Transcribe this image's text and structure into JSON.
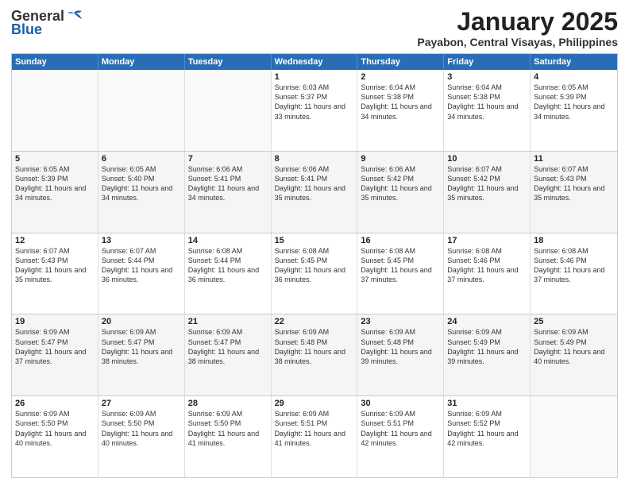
{
  "logo": {
    "line1": "General",
    "line2": "Blue"
  },
  "title": "January 2025",
  "subtitle": "Payabon, Central Visayas, Philippines",
  "days": [
    "Sunday",
    "Monday",
    "Tuesday",
    "Wednesday",
    "Thursday",
    "Friday",
    "Saturday"
  ],
  "weeks": [
    [
      {
        "num": "",
        "info": ""
      },
      {
        "num": "",
        "info": ""
      },
      {
        "num": "",
        "info": ""
      },
      {
        "num": "1",
        "info": "Sunrise: 6:03 AM\nSunset: 5:37 PM\nDaylight: 11 hours and 33 minutes."
      },
      {
        "num": "2",
        "info": "Sunrise: 6:04 AM\nSunset: 5:38 PM\nDaylight: 11 hours and 34 minutes."
      },
      {
        "num": "3",
        "info": "Sunrise: 6:04 AM\nSunset: 5:38 PM\nDaylight: 11 hours and 34 minutes."
      },
      {
        "num": "4",
        "info": "Sunrise: 6:05 AM\nSunset: 5:39 PM\nDaylight: 11 hours and 34 minutes."
      }
    ],
    [
      {
        "num": "5",
        "info": "Sunrise: 6:05 AM\nSunset: 5:39 PM\nDaylight: 11 hours and 34 minutes."
      },
      {
        "num": "6",
        "info": "Sunrise: 6:05 AM\nSunset: 5:40 PM\nDaylight: 11 hours and 34 minutes."
      },
      {
        "num": "7",
        "info": "Sunrise: 6:06 AM\nSunset: 5:41 PM\nDaylight: 11 hours and 34 minutes."
      },
      {
        "num": "8",
        "info": "Sunrise: 6:06 AM\nSunset: 5:41 PM\nDaylight: 11 hours and 35 minutes."
      },
      {
        "num": "9",
        "info": "Sunrise: 6:06 AM\nSunset: 5:42 PM\nDaylight: 11 hours and 35 minutes."
      },
      {
        "num": "10",
        "info": "Sunrise: 6:07 AM\nSunset: 5:42 PM\nDaylight: 11 hours and 35 minutes."
      },
      {
        "num": "11",
        "info": "Sunrise: 6:07 AM\nSunset: 5:43 PM\nDaylight: 11 hours and 35 minutes."
      }
    ],
    [
      {
        "num": "12",
        "info": "Sunrise: 6:07 AM\nSunset: 5:43 PM\nDaylight: 11 hours and 35 minutes."
      },
      {
        "num": "13",
        "info": "Sunrise: 6:07 AM\nSunset: 5:44 PM\nDaylight: 11 hours and 36 minutes."
      },
      {
        "num": "14",
        "info": "Sunrise: 6:08 AM\nSunset: 5:44 PM\nDaylight: 11 hours and 36 minutes."
      },
      {
        "num": "15",
        "info": "Sunrise: 6:08 AM\nSunset: 5:45 PM\nDaylight: 11 hours and 36 minutes."
      },
      {
        "num": "16",
        "info": "Sunrise: 6:08 AM\nSunset: 5:45 PM\nDaylight: 11 hours and 37 minutes."
      },
      {
        "num": "17",
        "info": "Sunrise: 6:08 AM\nSunset: 5:46 PM\nDaylight: 11 hours and 37 minutes."
      },
      {
        "num": "18",
        "info": "Sunrise: 6:08 AM\nSunset: 5:46 PM\nDaylight: 11 hours and 37 minutes."
      }
    ],
    [
      {
        "num": "19",
        "info": "Sunrise: 6:09 AM\nSunset: 5:47 PM\nDaylight: 11 hours and 37 minutes."
      },
      {
        "num": "20",
        "info": "Sunrise: 6:09 AM\nSunset: 5:47 PM\nDaylight: 11 hours and 38 minutes."
      },
      {
        "num": "21",
        "info": "Sunrise: 6:09 AM\nSunset: 5:47 PM\nDaylight: 11 hours and 38 minutes."
      },
      {
        "num": "22",
        "info": "Sunrise: 6:09 AM\nSunset: 5:48 PM\nDaylight: 11 hours and 38 minutes."
      },
      {
        "num": "23",
        "info": "Sunrise: 6:09 AM\nSunset: 5:48 PM\nDaylight: 11 hours and 39 minutes."
      },
      {
        "num": "24",
        "info": "Sunrise: 6:09 AM\nSunset: 5:49 PM\nDaylight: 11 hours and 39 minutes."
      },
      {
        "num": "25",
        "info": "Sunrise: 6:09 AM\nSunset: 5:49 PM\nDaylight: 11 hours and 40 minutes."
      }
    ],
    [
      {
        "num": "26",
        "info": "Sunrise: 6:09 AM\nSunset: 5:50 PM\nDaylight: 11 hours and 40 minutes."
      },
      {
        "num": "27",
        "info": "Sunrise: 6:09 AM\nSunset: 5:50 PM\nDaylight: 11 hours and 40 minutes."
      },
      {
        "num": "28",
        "info": "Sunrise: 6:09 AM\nSunset: 5:50 PM\nDaylight: 11 hours and 41 minutes."
      },
      {
        "num": "29",
        "info": "Sunrise: 6:09 AM\nSunset: 5:51 PM\nDaylight: 11 hours and 41 minutes."
      },
      {
        "num": "30",
        "info": "Sunrise: 6:09 AM\nSunset: 5:51 PM\nDaylight: 11 hours and 42 minutes."
      },
      {
        "num": "31",
        "info": "Sunrise: 6:09 AM\nSunset: 5:52 PM\nDaylight: 11 hours and 42 minutes."
      },
      {
        "num": "",
        "info": ""
      }
    ]
  ]
}
